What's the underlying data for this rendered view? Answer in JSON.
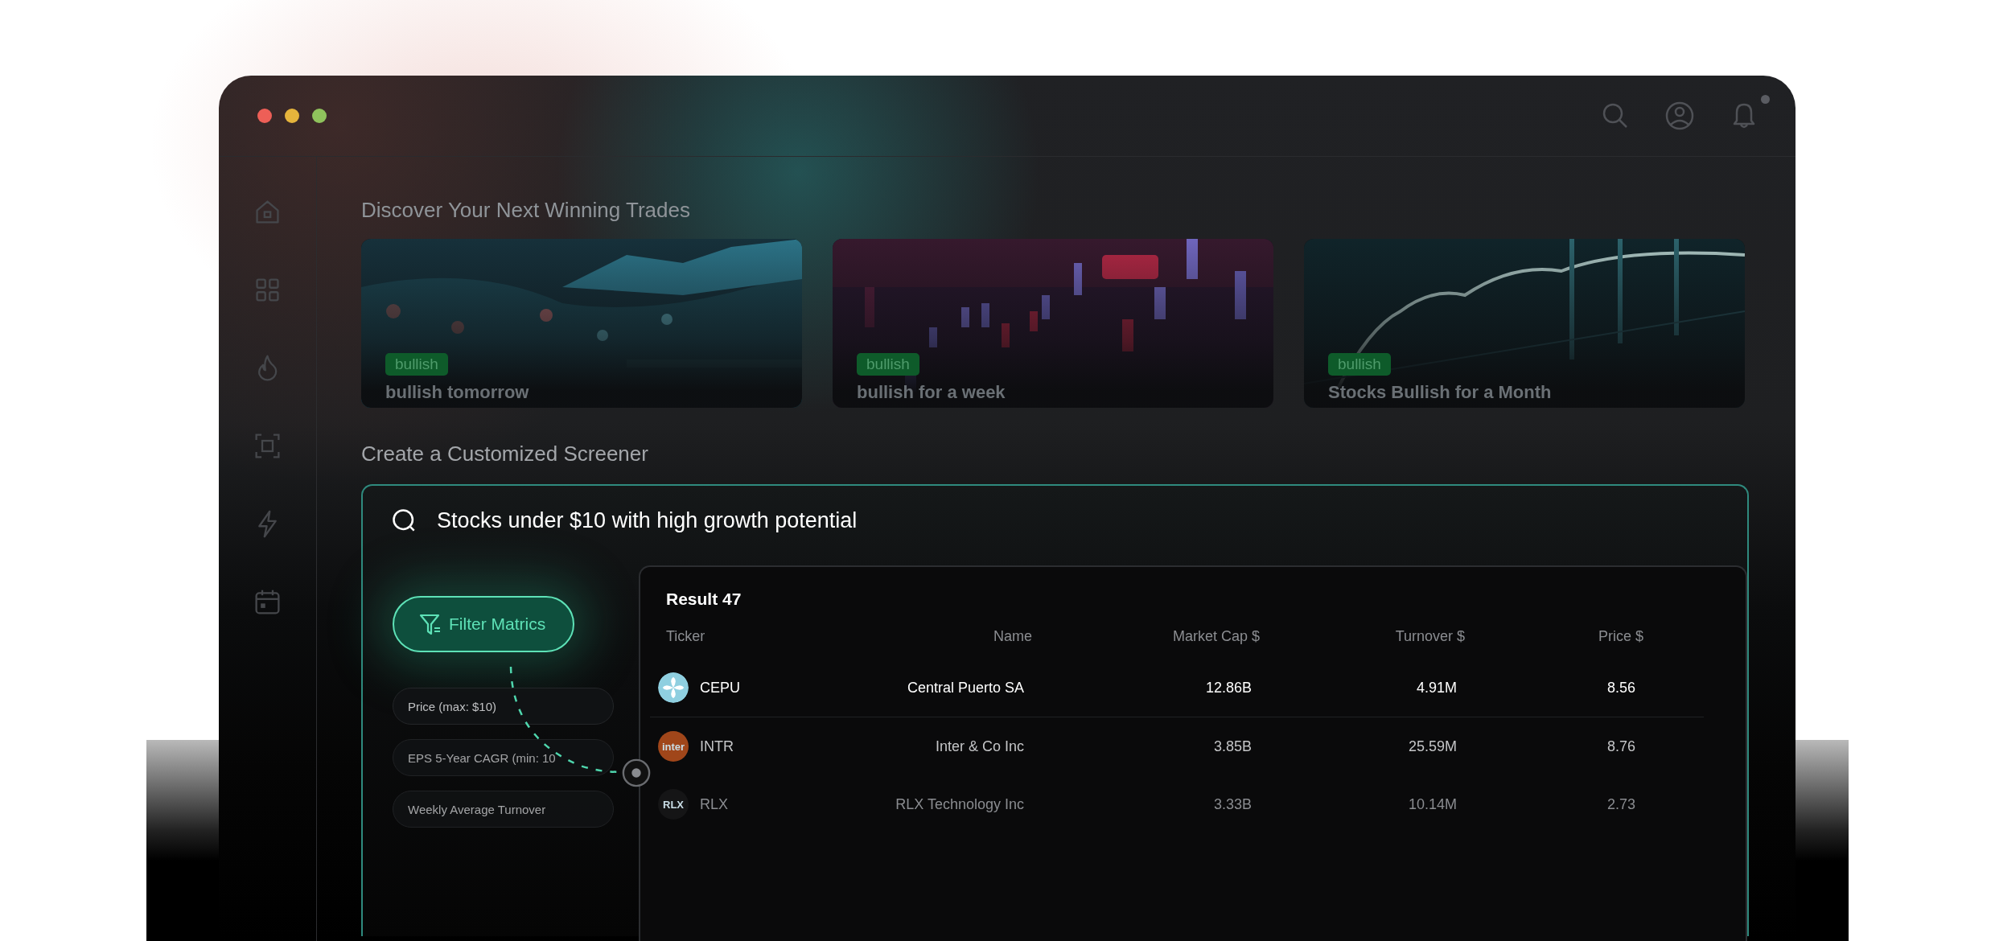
{
  "window": {
    "controls": [
      {
        "color": "#ed5f57"
      },
      {
        "color": "#e5b43c"
      },
      {
        "color": "#8fc25c"
      }
    ],
    "notification_dot": true
  },
  "discover": {
    "title": "Discover Your Next Winning Trades",
    "cards": [
      {
        "kind": "picture",
        "tag": "bullish",
        "title": "bullish tomorrow"
      },
      {
        "kind": "picture",
        "tag": "bullish",
        "title": "bullish for a week"
      },
      {
        "kind": "picture",
        "tag": "bullish",
        "title": "Stocks Bullish for a Month"
      }
    ]
  },
  "screener": {
    "title": "Create a Customized Screener",
    "search": {
      "value": "Stocks under $10 with high growth potential"
    },
    "filter_button": {
      "label": "Filter Matrics"
    },
    "filters": [
      "Price (max: $10)",
      "EPS 5-Year CAGR (min: 10",
      "Weekly Average Turnover"
    ],
    "results": {
      "title": "Result 47",
      "columns": [
        "Ticker",
        "Name",
        "Market Cap $",
        "Turnover $",
        "Price $"
      ],
      "rows": [
        {
          "logo": {
            "kind": "pinwheel"
          },
          "ticker": "CEPU",
          "name": "Central Puerto SA",
          "market_cap": "12.86B",
          "turnover": "4.91M",
          "price": "8.56"
        },
        {
          "logo": {
            "kind": "text",
            "text": "inter",
            "color": "#a0461a"
          },
          "ticker": "INTR",
          "name": "Inter & Co Inc",
          "market_cap": "3.85B",
          "turnover": "25.59M",
          "price": "8.76"
        },
        {
          "logo": {
            "kind": "text",
            "text": "RLX",
            "color": "#151516"
          },
          "ticker": "RLX",
          "name": "RLX Technology Inc",
          "market_cap": "3.33B",
          "turnover": "10.14M",
          "price": "2.73"
        }
      ]
    }
  }
}
